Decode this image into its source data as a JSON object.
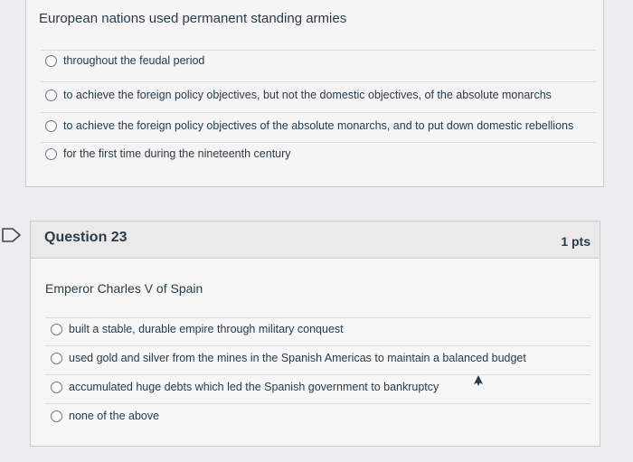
{
  "prev_question": {
    "text": "European nations used permanent standing armies",
    "answers": [
      "throughout the feudal period",
      "to achieve the foreign policy objectives, but not the domestic objectives, of the absolute monarchs",
      "to achieve the foreign policy objectives of the absolute monarchs, and to put down domestic rebellions",
      "for the first time during the nineteenth century"
    ]
  },
  "question": {
    "title": "Question 23",
    "points": "1 pts",
    "text": "Emperor Charles V of Spain",
    "answers": [
      "built a stable, durable empire through military conquest",
      "used gold and silver from the mines in the Spanish Americas to maintain a balanced budget",
      "accumulated huge debts which led the Spanish government to bankruptcy",
      "none of the above"
    ]
  },
  "icons": {
    "flag": "unanswered-flag-icon",
    "radio": "radio-button-icon",
    "cursor": "mouse-pointer-icon"
  }
}
